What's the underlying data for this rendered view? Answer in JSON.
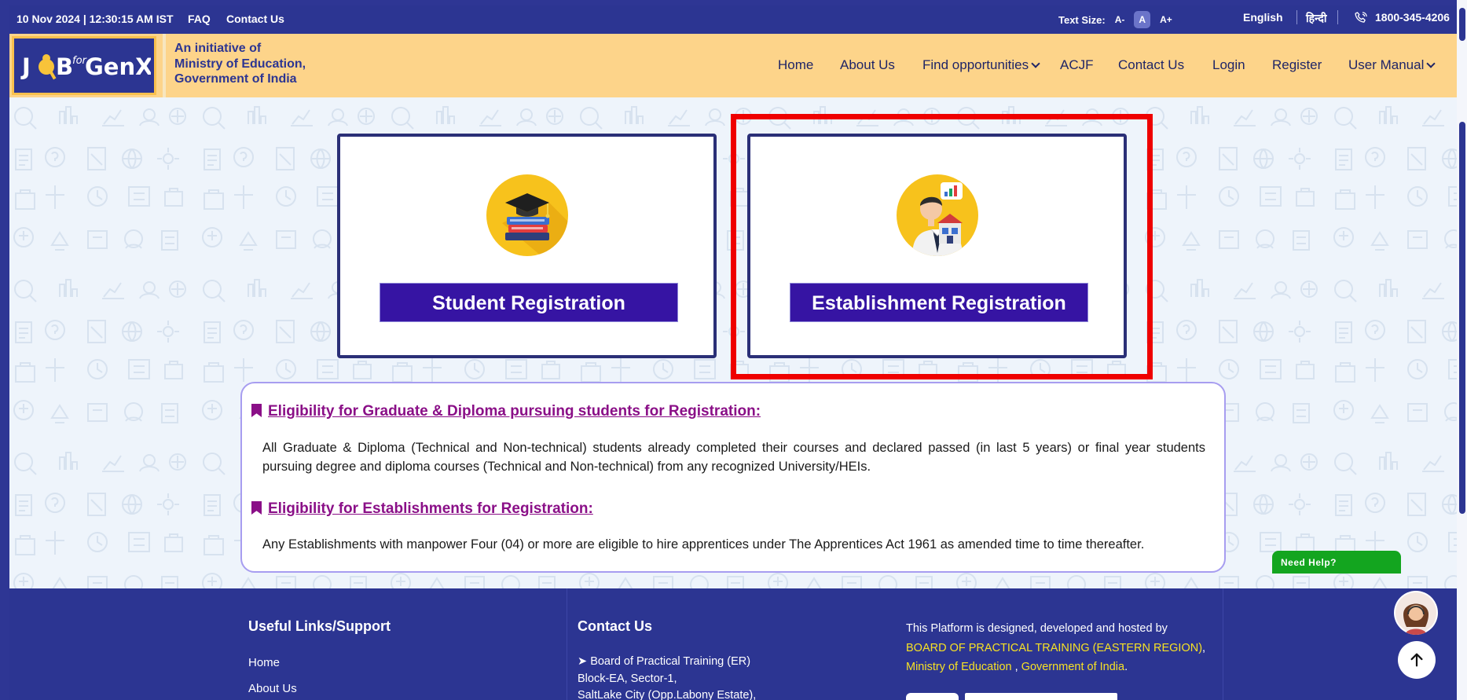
{
  "topbar": {
    "datetime": "10 Nov 2024 | 12:30:15 AM IST",
    "faq": "FAQ",
    "contact": "Contact Us",
    "text_size_label": "Text Size:",
    "text_size_options": [
      "A-",
      "A",
      "A+"
    ],
    "language_en": "English",
    "language_hi": "हिन्दी",
    "phone": "1800-345-4206"
  },
  "header": {
    "logo_text": "JOBforGenX",
    "initiative_lines": [
      "An initiative of",
      "Ministry of Education,",
      "Government of India"
    ],
    "nav": [
      "Home",
      "About Us",
      "Find opportunities",
      "ACJF",
      "Contact Us",
      "Login",
      "Register",
      "User Manual"
    ]
  },
  "cards": {
    "student": {
      "label": "Student Registration",
      "icon": "graduation-cap-books-icon"
    },
    "establishment": {
      "label": "Establishment Registration",
      "icon": "businessman-building-icon"
    }
  },
  "eligibility": {
    "graduate_title": "Eligibility for Graduate & Diploma pursuing students for Registration:",
    "graduate_text": "All Graduate & Diploma (Technical and Non-technical) students already completed their courses and declared passed (in last 5 years) or final year students pursuing degree and diploma courses (Technical and Non-technical) from any recognized University/HEIs.",
    "establishment_title": "Eligibility for Establishments for Registration:",
    "establishment_text": "Any Establishments with manpower Four (04) or more are eligible to hire apprentices under The Apprentices Act 1961 as amended time to time thereafter."
  },
  "need_help": "Need Help?",
  "footer": {
    "useful_title": "Useful Links/Support",
    "useful_links": [
      "Home",
      "About Us"
    ],
    "contact_title": "Contact Us",
    "address_lines": [
      "Board of Practical Training (ER)",
      "Block-EA, Sector-1,",
      "SaltLake City (Opp.Labony Estate),"
    ],
    "designed_by": "This Platform is designed, developed and hosted by",
    "board_name": "BOARD OF PRACTICAL TRAINING (EASTERN REGION)",
    "ministry": "Ministry of Education",
    "government": "Government of India"
  },
  "colors": {
    "primary": "#2c3592",
    "header_bg": "#fdd48a",
    "button": "#3614a3",
    "heading_accent": "#8a0f87",
    "highlight": "#ef0000",
    "need_help": "#13a51f"
  }
}
